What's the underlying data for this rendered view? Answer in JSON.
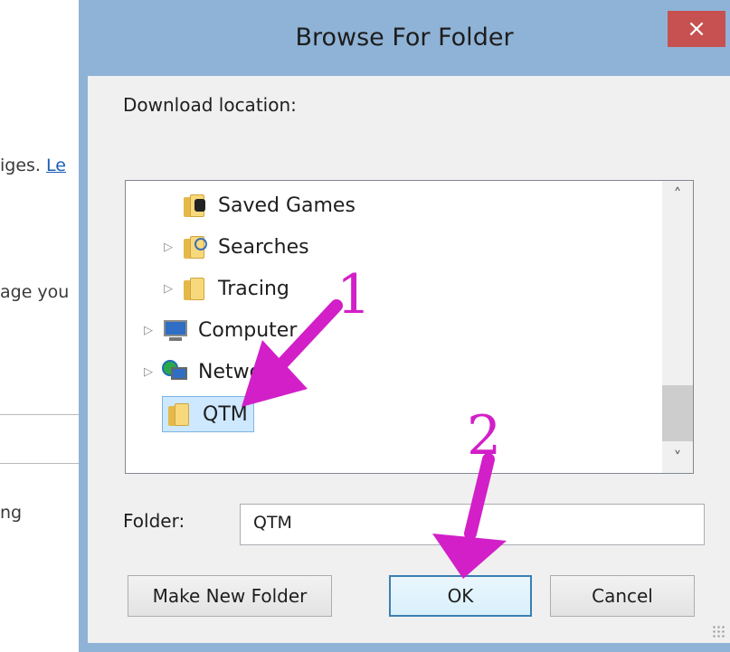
{
  "background": {
    "fragment_1": "iges.",
    "fragment_1_link": "Le",
    "fragment_2": "age you",
    "fragment_3": "ng"
  },
  "dialog": {
    "title": "Browse For Folder",
    "close_label": "×",
    "prompt": "Download location:",
    "tree": {
      "items": [
        {
          "label": "Saved Games",
          "icon": "saved-games-folder-icon",
          "expandable": false
        },
        {
          "label": "Searches",
          "icon": "search-folder-icon",
          "expandable": true
        },
        {
          "label": "Tracing",
          "icon": "folder-icon",
          "expandable": true
        },
        {
          "label": "Computer",
          "icon": "computer-icon",
          "expandable": true
        },
        {
          "label": "Network",
          "icon": "network-icon",
          "expandable": true
        },
        {
          "label": "QTM",
          "icon": "folder-icon",
          "expandable": false,
          "selected": true
        }
      ],
      "expander_glyph": "▷",
      "scroll_up": "˄",
      "scroll_down": "˅"
    },
    "folder_label": "Folder:",
    "folder_value": "QTM",
    "buttons": {
      "make_new_folder": "Make New Folder",
      "ok": "OK",
      "cancel": "Cancel"
    }
  },
  "annotations": {
    "step_1": "1",
    "step_2": "2",
    "arrow_color": "#d21fc8"
  }
}
